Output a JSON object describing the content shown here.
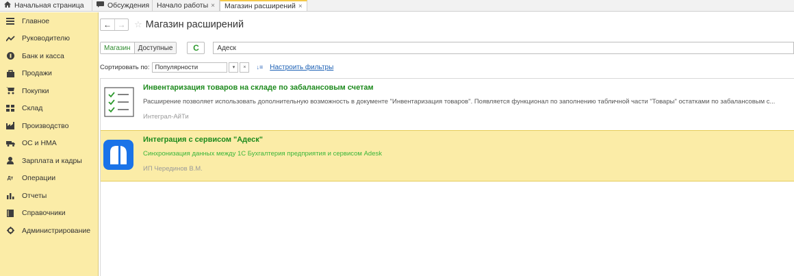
{
  "tabs": [
    {
      "label": "Начальная страница",
      "icon": "home-icon"
    },
    {
      "label": "Обсуждения",
      "icon": "chat-icon"
    },
    {
      "label": "Начало работы",
      "closable": true
    },
    {
      "label": "Магазин расширений",
      "closable": true,
      "active": true
    }
  ],
  "sidebar": {
    "items": [
      {
        "label": "Главное",
        "icon": "menu-icon"
      },
      {
        "label": "Руководителю",
        "icon": "trend-icon"
      },
      {
        "label": "Банк и касса",
        "icon": "bank-icon"
      },
      {
        "label": "Продажи",
        "icon": "bag-icon"
      },
      {
        "label": "Покупки",
        "icon": "cart-icon"
      },
      {
        "label": "Склад",
        "icon": "warehouse-icon"
      },
      {
        "label": "Производство",
        "icon": "factory-icon"
      },
      {
        "label": "ОС и НМА",
        "icon": "truck-icon"
      },
      {
        "label": "Зарплата и кадры",
        "icon": "person-icon"
      },
      {
        "label": "Операции",
        "icon": "operations-icon"
      },
      {
        "label": "Отчеты",
        "icon": "chart-icon"
      },
      {
        "label": "Справочники",
        "icon": "book-icon"
      },
      {
        "label": "Администрирование",
        "icon": "gear-icon"
      }
    ]
  },
  "page": {
    "title": "Магазин расширений",
    "back_glyph": "←",
    "forward_glyph": "→",
    "star_glyph": "☆"
  },
  "toolbar": {
    "store_label": "Магазин",
    "available_label": "Доступные",
    "refresh_glyph": "C",
    "search_value": "Адеск"
  },
  "sort": {
    "label": "Сортировать по:",
    "value": "Популярности",
    "dropdown_glyph": "▾",
    "clear_glyph": "×",
    "direction_glyph": "↓≡",
    "filters_link": "Настроить фильтры"
  },
  "extensions": [
    {
      "title": "Инвентаризация товаров на складе по забалансовым счетам",
      "description": "Расширение позволяет использовать дополнительную возможность в документе \"Инвентаризация товаров\". Появляется функционал по заполнению табличной части \"Товары\" остатками по забалансовым с...",
      "author": "Интеграл-АйТи",
      "icon": "checklist-icon"
    },
    {
      "title": "Интеграция с сервисом \"Адеск\"",
      "description": "Синхронизация данных между 1С Бухгалтерия предприятия и сервисом Adesk",
      "author": "ИП Черединов В.М.",
      "icon": "adesk-logo-icon",
      "selected": true
    }
  ],
  "colors": {
    "sidebar_bg": "#fbeca7",
    "accent_green": "#1d8a1d",
    "link_blue": "#1a5fb4",
    "adesk_blue": "#1a73e8"
  }
}
